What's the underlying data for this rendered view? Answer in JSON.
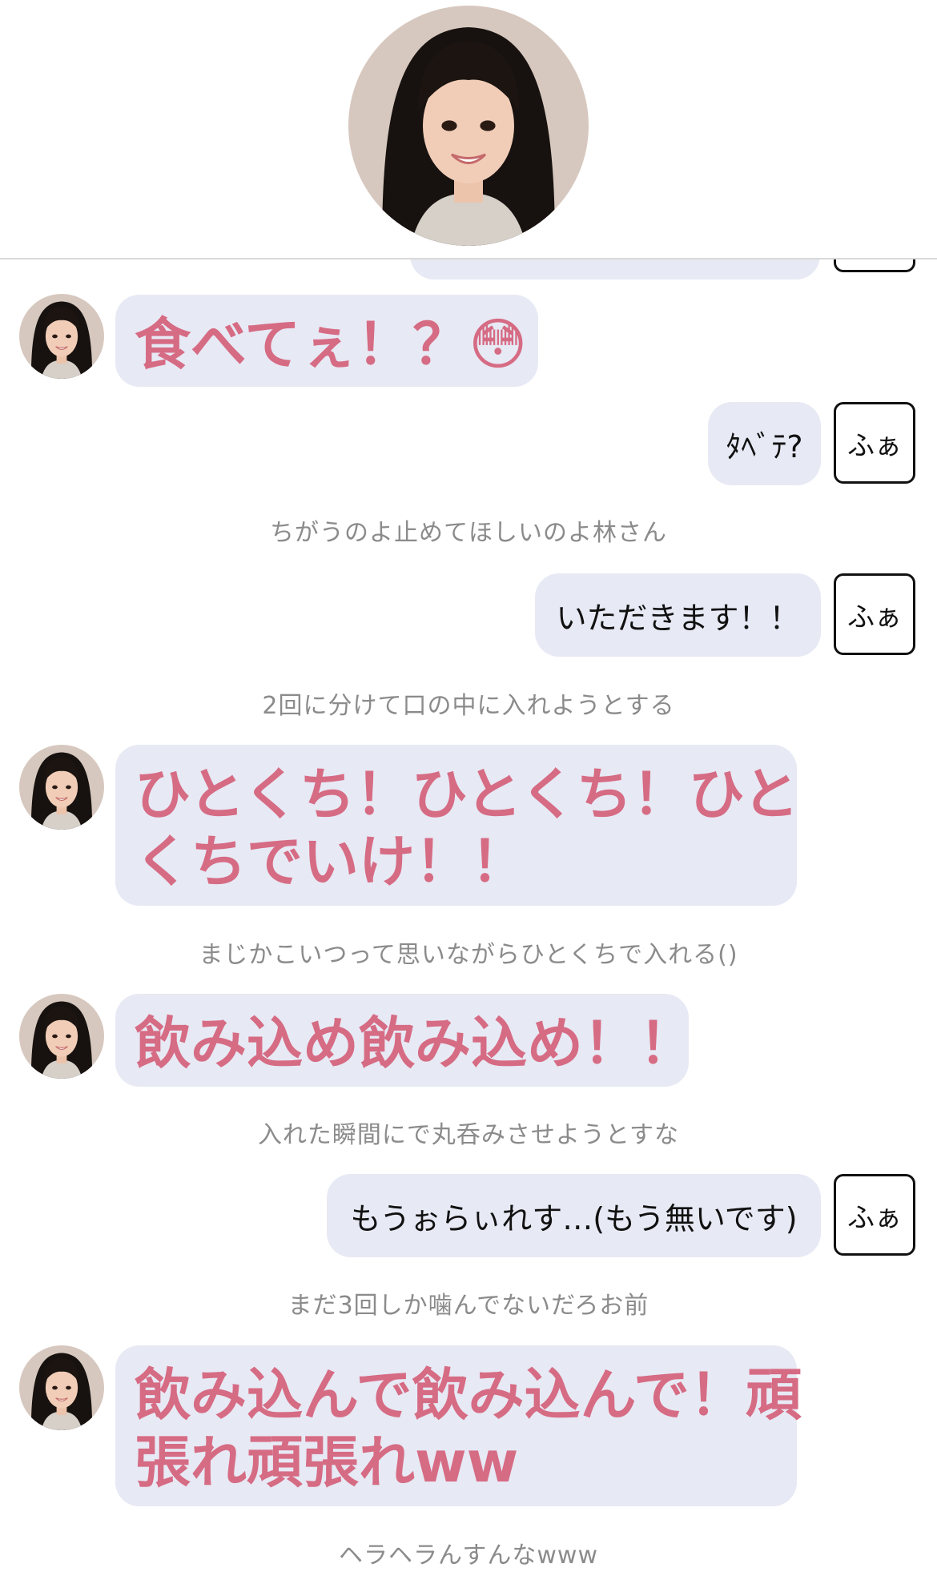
{
  "header": {
    "avatar_icon": "girl-portrait-icon"
  },
  "colors": {
    "bubble_bg": "#e7e9f4",
    "left_text": "#d66b84",
    "narration_text": "#8b8b8b"
  },
  "messages": {
    "m1": "食べてぇ！？😳",
    "m2": "ﾀﾍﾞﾃ?",
    "m2_tag": "ふぁ",
    "n1": "ちがうのよ止めてほしいのよ林さん",
    "m3": "いただきます！！",
    "m3_tag": "ふぁ",
    "n2": "2回に分けて口の中に入れようとする",
    "m4_line1": "ひとくち！ひとくち！ひと",
    "m4_line2": "くちでいけ！！",
    "n3": "まじかこいつって思いながらひとくちで入れる()",
    "m5": "飲み込め飲み込め！！",
    "n4": "入れた瞬間にで丸呑みさせようとすな",
    "m6": "もうぉらぃれす…(もう無いです)",
    "m6_tag": "ふぁ",
    "n5": "まだ3回しか噛んでないだろお前",
    "m7_line1": "飲み込んで飲み込んで！頑",
    "m7_line2": "張れ頑張れww",
    "n6": "ヘラヘラんすんなwww"
  }
}
